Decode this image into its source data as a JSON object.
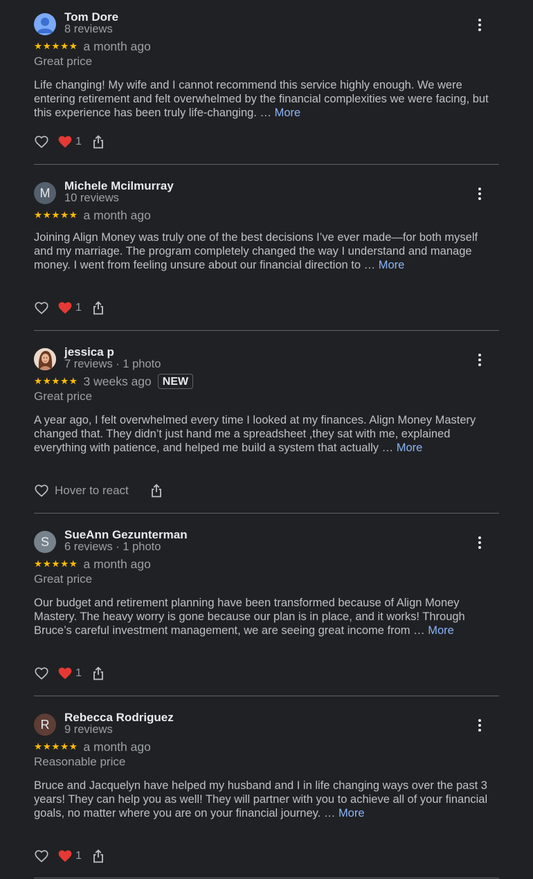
{
  "reviews": [
    {
      "name": "Tom Dore",
      "meta": "8 reviews",
      "stars": "★★★★★",
      "time": "a month ago",
      "price": "Great price",
      "text": "Life changing! My wife and I cannot recommend this service highly enough. We were entering retirement and felt overwhelmed by the financial complexities we were facing, but this experience has been truly life-changing. …",
      "more": "More",
      "reaction_count": "1",
      "avatar_color": "#7baaf7"
    },
    {
      "name": "Michele Mcilmurray",
      "meta": "10 reviews",
      "stars": "★★★★★",
      "time": "a month ago",
      "text": "Joining Align Money was truly one of the best decisions I’ve ever made—for both myself and my marriage. The program completely changed the way I understand and manage money. I went from feeling unsure about our financial direction to …",
      "more": "More",
      "reaction_count": "1",
      "avatar_letter": "M",
      "avatar_color": "#54606d"
    },
    {
      "name": "jessica p",
      "meta": "7 reviews · 1 photo",
      "stars": "★★★★★",
      "time": "3 weeks ago",
      "badge": "NEW",
      "price": "Great price",
      "text": "A year ago, I felt overwhelmed every time I looked at my finances. Align Money Mastery changed that. They didn’t just hand me a spreadsheet ,they sat with me, explained everything with patience, and helped me build a system that actually …",
      "more": "More",
      "hover_label": "Hover to react"
    },
    {
      "name": "SueAnn Gezunterman",
      "meta": "6 reviews · 1 photo",
      "stars": "★★★★★",
      "time": "a month ago",
      "price": "Great price",
      "text": "Our budget and retirement planning have been transformed because of Align Money Mastery. The heavy worry is gone because our plan is in place, and it works! Through Bruce’s careful investment management, we are seeing great income from …",
      "more": "More",
      "reaction_count": "1",
      "avatar_letter": "S",
      "avatar_color": "#76828c"
    },
    {
      "name": "Rebecca Rodriguez",
      "meta": "9 reviews",
      "stars": "★★★★★",
      "time": "a month ago",
      "price": "Reasonable price",
      "text": "Bruce and Jacquelyn have helped my husband and I in life changing ways over the past 3 years! They can help you as well! They will partner with you to achieve all of your financial goals, no matter where you are on your financial journey. …",
      "more": "More",
      "reaction_count": "1",
      "avatar_letter": "R",
      "avatar_color": "#5d3d35"
    }
  ]
}
